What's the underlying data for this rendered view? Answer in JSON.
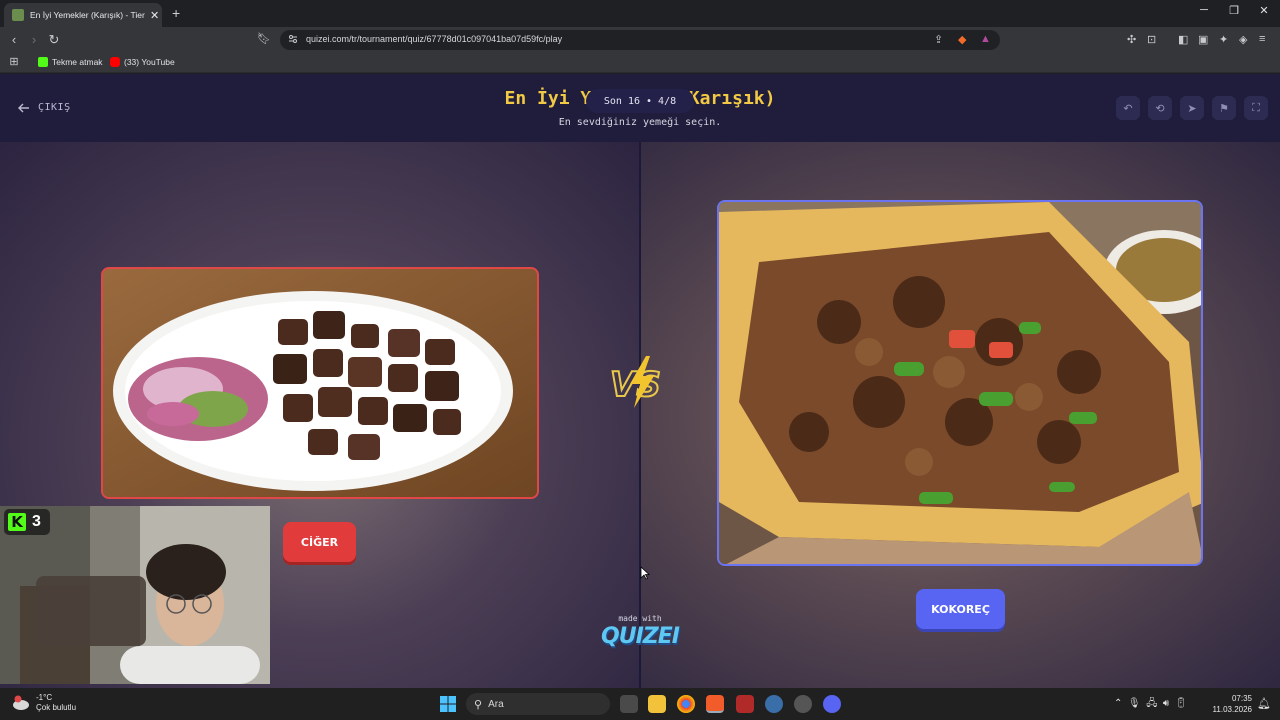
{
  "browser": {
    "tab_title": "En İyi Yemekler (Karışık) - Tier Li",
    "tab_close": "✕",
    "new_tab": "+",
    "url": "quizei.com/tr/tournament/quiz/67778d01c097041ba07d59fc/play",
    "bookmarks": [
      {
        "label": "Tekme atmak",
        "color": "#53fc18"
      },
      {
        "label": "(33) YouTube",
        "color": "#ff0000"
      }
    ]
  },
  "page": {
    "exit_label": "ÇIKIŞ",
    "title": "En İyi Yemekler (Karışık)",
    "subtitle": "En sevdiğiniz yemeği seçin.",
    "round_badge": "Son 16 • 4/8",
    "left_choice": {
      "label": "CİĞER",
      "accent": "#e23b3b"
    },
    "right_choice": {
      "label": "KOKOREÇ",
      "accent": "#5865f2"
    },
    "vs_text": "VS",
    "made_with": "made with",
    "brand": "QUIZEI"
  },
  "overlay": {
    "kick_badge_count": "3"
  },
  "taskbar": {
    "weather_temp": "-1°C",
    "weather_desc": "Çok bulutlu",
    "search_label": "Ara",
    "time": "07:35",
    "date": "11.03.2026"
  }
}
